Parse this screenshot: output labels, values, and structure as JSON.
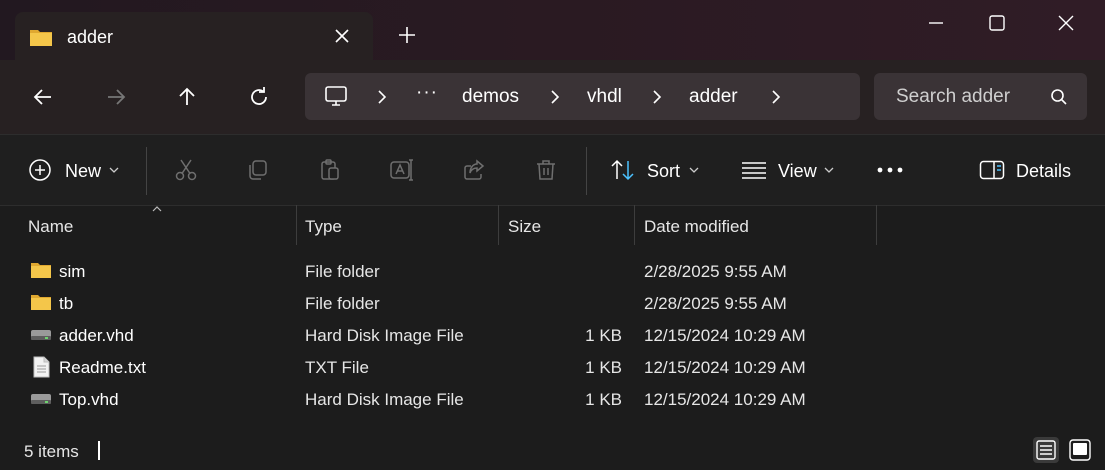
{
  "window": {
    "tab_title": "adder"
  },
  "address": {
    "overflow": "···",
    "segments": [
      "demos",
      "vhdl",
      "adder"
    ]
  },
  "search": {
    "placeholder": "Search adder"
  },
  "toolbar": {
    "new_label": "New",
    "sort_label": "Sort",
    "view_label": "View",
    "details_label": "Details"
  },
  "columns": {
    "name": "Name",
    "type": "Type",
    "size": "Size",
    "date": "Date modified"
  },
  "files": [
    {
      "name": "sim",
      "type": "File folder",
      "size": "",
      "date": "2/28/2025 9:55 AM",
      "icon": "folder-icon"
    },
    {
      "name": "tb",
      "type": "File folder",
      "size": "",
      "date": "2/28/2025 9:55 AM",
      "icon": "folder-icon"
    },
    {
      "name": "adder.vhd",
      "type": "Hard Disk Image File",
      "size": "1 KB",
      "date": "12/15/2024 10:29 AM",
      "icon": "disk-image-icon"
    },
    {
      "name": "Readme.txt",
      "type": "TXT File",
      "size": "1 KB",
      "date": "12/15/2024 10:29 AM",
      "icon": "text-file-icon"
    },
    {
      "name": "Top.vhd",
      "type": "Hard Disk Image File",
      "size": "1 KB",
      "date": "12/15/2024 10:29 AM",
      "icon": "disk-image-icon"
    }
  ],
  "status": {
    "item_count": "5 items"
  },
  "colors": {
    "folder": "#f4c64a",
    "accent": "#4cc2ff"
  }
}
